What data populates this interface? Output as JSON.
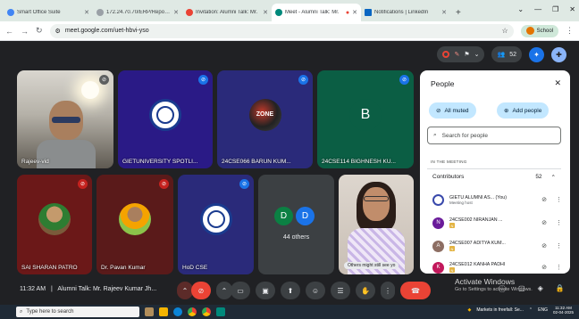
{
  "browser": {
    "tabs": [
      {
        "label": "Smart Office Suite",
        "color": "#4285f4"
      },
      {
        "label": "172.24.70.70/ERP/Reports/Rai",
        "color": "#9aa0a6"
      },
      {
        "label": "Invitation: Alumni Talk: Mr. ",
        "color": "#ea4335"
      },
      {
        "label": "Meet - Alumni Talk: Mr.",
        "color": "#00897b"
      },
      {
        "label": "Notifications | LinkedIn",
        "color": "#0a66c2"
      }
    ],
    "new_tab": "+",
    "url": "meet.google.com/uet-hbvi-yso",
    "profile_label": "School"
  },
  "meet_top": {
    "people_count": "52"
  },
  "tiles": [
    {
      "name": "Rajeev-vid",
      "type": "camera",
      "color": "#8a8a84"
    },
    {
      "name": "GIETUNIVERSITY SPOTLI...",
      "type": "seal",
      "color": "#2a1a86"
    },
    {
      "name": "24CSE066 BARUN KUM...",
      "type": "photo",
      "color": "#2a2a7a"
    },
    {
      "name": "24CSE114 BIGHNESH KU...",
      "type": "letter",
      "letter": "B",
      "color": "#0b5e44"
    },
    {
      "name": "SAI SHARAN PATRO",
      "type": "photo",
      "color": "#6b1818"
    },
    {
      "name": "Dr. Pavan Kumar",
      "type": "photo",
      "color": "#5a1a1a"
    },
    {
      "name": "HoD CSE",
      "type": "seal",
      "color": "#2a2a7a"
    },
    {
      "name": "44 others",
      "type": "group",
      "letters": [
        "D",
        "D"
      ],
      "color": "#3c4043"
    },
    {
      "name": "Others might still see yo",
      "type": "self",
      "color": "#c9c0b8"
    }
  ],
  "bottom": {
    "time": "11:32 AM",
    "separator": "|",
    "meeting_title": "Alumni Talk: Mr. Rajeev Kumar Jh..."
  },
  "people_panel": {
    "title": "People",
    "all_muted": "All muted",
    "add_people": "Add people",
    "search_placeholder": "Search for people",
    "section": "IN THE MEETING",
    "contributors_label": "Contributors",
    "contributors_count": "52",
    "people": [
      {
        "name": "GIETU ALUMNI AS... (You)",
        "sub": "Meeting host",
        "avatar": "#3949ab",
        "initial": "",
        "badge": ""
      },
      {
        "name": "24CSE002 NIRANJAN ...",
        "sub": "",
        "avatar": "#6a1b9a",
        "initial": "N",
        "badge": "N"
      },
      {
        "name": "24CSE007 ADITYA KUM...",
        "sub": "",
        "avatar": "#8d6e63",
        "initial": "A",
        "badge": "N"
      },
      {
        "name": "24CSE012 KANHA PADHI",
        "sub": "",
        "avatar": "#c2185b",
        "initial": "K",
        "badge": "N"
      }
    ]
  },
  "watermark": {
    "title": "Activate Windows",
    "sub": "Go to Settings to activate Windows."
  },
  "taskbar": {
    "search_placeholder": "Type here to search",
    "news": "Markets in freefall: Se...",
    "lang": "ENG",
    "clock_time": "11:32 AM",
    "clock_date": "02-04-2025"
  }
}
